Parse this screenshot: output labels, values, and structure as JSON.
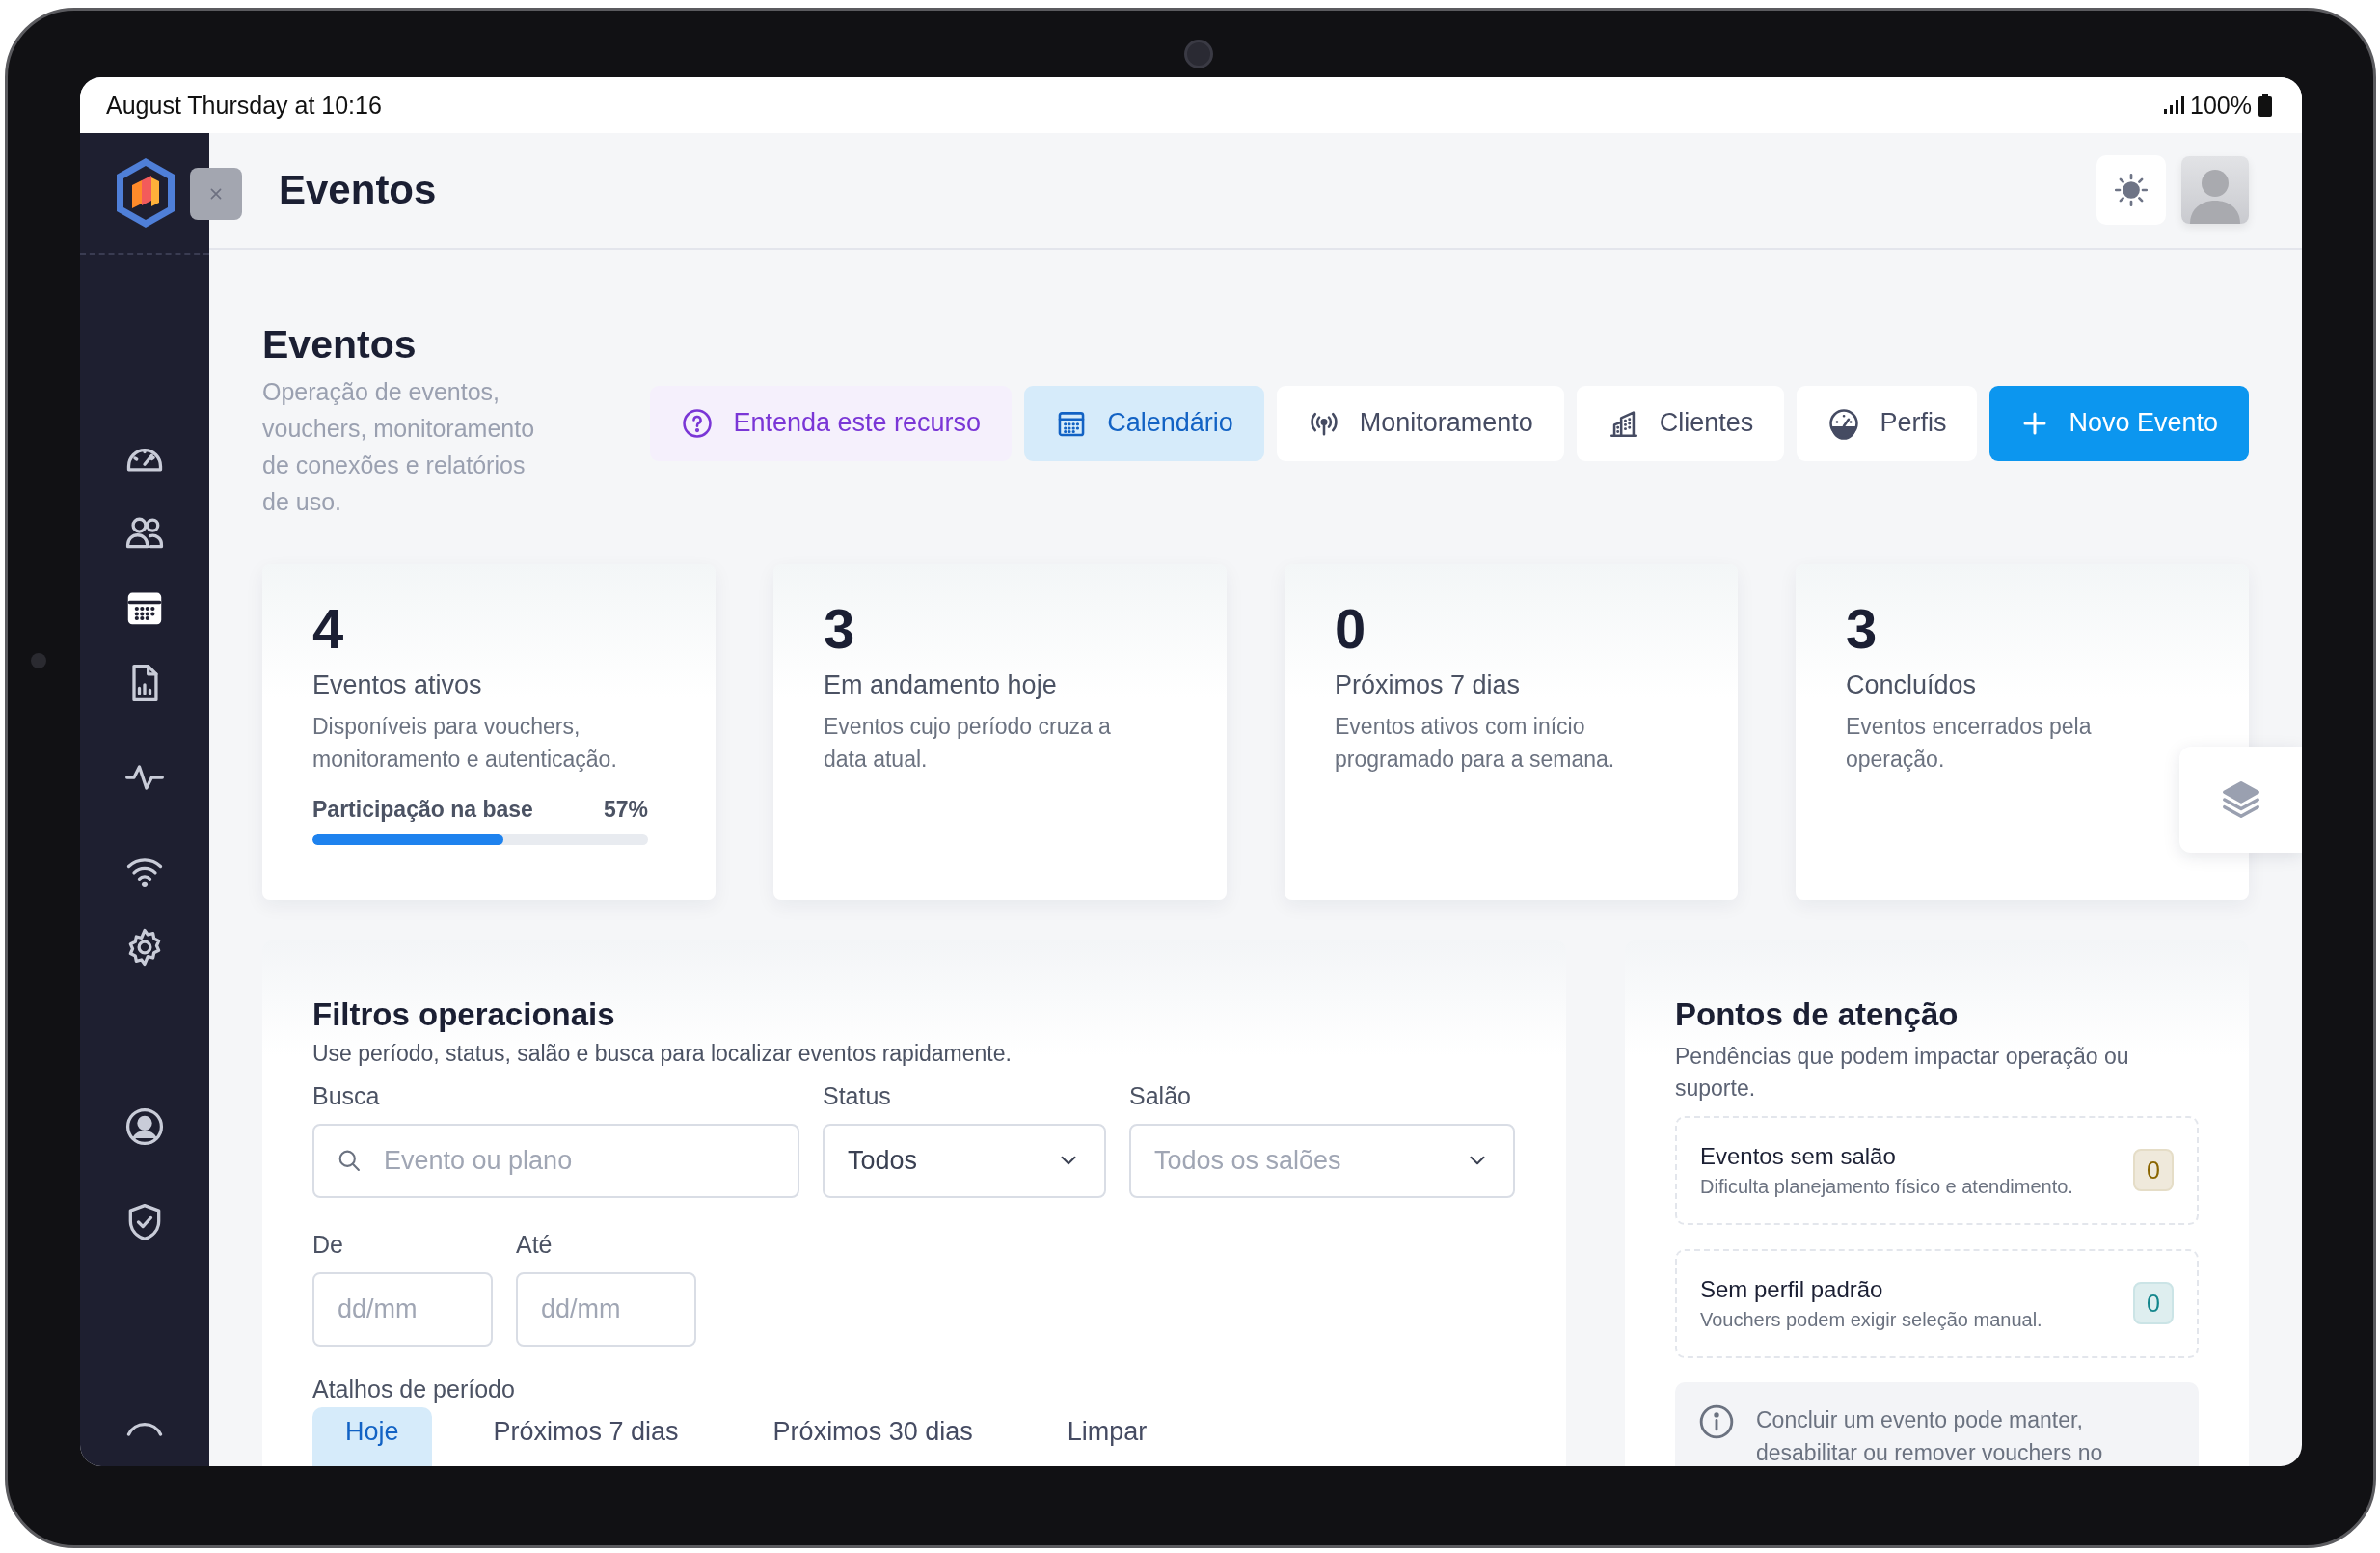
{
  "status_bar": {
    "time": "August Thursday at 10:16",
    "battery": "100%"
  },
  "sidebar": {
    "groups": [
      {
        "items": [
          {
            "kind": "dashboard",
            "selected": false
          },
          {
            "kind": "users",
            "selected": false
          },
          {
            "kind": "calendar",
            "selected": true
          },
          {
            "kind": "report",
            "selected": false
          }
        ]
      },
      {
        "items": [
          {
            "kind": "activity",
            "selected": false
          }
        ]
      },
      {
        "items": [
          {
            "kind": "wifi",
            "selected": false
          },
          {
            "kind": "settings",
            "selected": false
          }
        ]
      },
      {
        "items": [
          {
            "kind": "account",
            "selected": false
          },
          {
            "kind": "security",
            "selected": false
          }
        ]
      },
      {
        "items": [
          {
            "kind": "arc",
            "selected": false
          }
        ]
      }
    ]
  },
  "header": {
    "title": "Eventos"
  },
  "page": {
    "title": "Eventos",
    "description": "Operação de eventos, vouchers, monitoramento de conexões e relatórios de uso."
  },
  "actions": [
    {
      "kind": "help",
      "label": "Entenda este recurso",
      "selected": false
    },
    {
      "kind": "calendar",
      "label": "Calendário",
      "selected": true
    },
    {
      "kind": "monitor",
      "label": "Monitoramento",
      "selected": false
    },
    {
      "kind": "clients",
      "label": "Clientes",
      "selected": false
    },
    {
      "kind": "profiles",
      "label": "Perfis",
      "selected": false
    },
    {
      "kind": "primary",
      "label": "Novo Evento",
      "selected": false
    }
  ],
  "stats": [
    {
      "value": "4",
      "label": "Eventos ativos",
      "description": "Disponíveis para vouchers, monitoramento e autenticação.",
      "progress": {
        "label": "Participação na base",
        "reading": "57%",
        "level": 0.57
      }
    },
    {
      "value": "3",
      "label": "Em andamento hoje",
      "description": "Eventos cujo período cruza a data atual."
    },
    {
      "value": "0",
      "label": "Próximos 7 dias",
      "description": "Eventos ativos com início programado para a semana."
    },
    {
      "value": "3",
      "label": "Concluídos",
      "description": "Eventos encerrados pela operação."
    }
  ],
  "filters": {
    "title": "Filtros operacionais",
    "subtitle": "Use período, status, salão e busca para localizar eventos rapidamente.",
    "fields": [
      {
        "kind": "search",
        "label": "Busca",
        "placeholder": "Evento ou plano"
      },
      {
        "kind": "select",
        "label": "Status",
        "value": "Todos"
      },
      {
        "kind": "select",
        "label": "Salão",
        "placeholder": "Todos os salões"
      }
    ],
    "dates": [
      {
        "label": "De",
        "placeholder": "dd/mm"
      },
      {
        "label": "Até",
        "placeholder": "dd/mm"
      }
    ],
    "shortcuts_label": "Atalhos de período",
    "shortcuts": [
      {
        "label": "Hoje",
        "selected": true
      },
      {
        "label": "Próximos 7 dias",
        "selected": false
      },
      {
        "label": "Próximos 30 dias",
        "selected": false
      },
      {
        "label": "Limpar",
        "selected": false
      }
    ]
  },
  "attention": {
    "title": "Pontos de atenção",
    "subtitle": "Pendências que podem impactar operação ou suporte.",
    "items": [
      {
        "title": "Eventos sem salão",
        "description": "Dificulta planejamento físico e atendimento.",
        "count": "0",
        "color": "#8a6500"
      },
      {
        "title": "Sem perfil padrão",
        "description": "Vouchers podem exigir seleção manual.",
        "count": "0",
        "color": "#14868c"
      }
    ],
    "note": "Concluir um evento pode manter, desabilitar ou remover vouchers no"
  }
}
